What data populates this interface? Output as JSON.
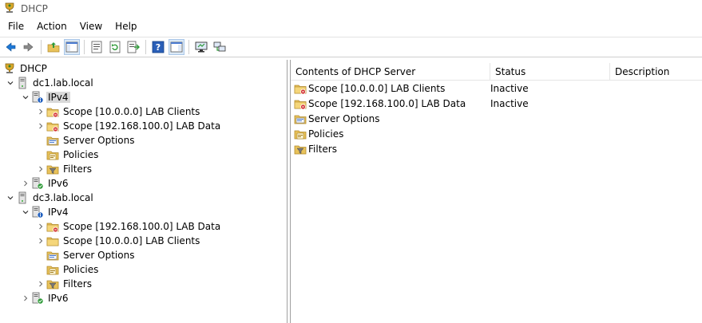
{
  "window": {
    "title": "DHCP"
  },
  "menu": {
    "items": [
      "File",
      "Action",
      "View",
      "Help"
    ]
  },
  "toolbar": {
    "buttons": [
      "back-arrow-icon",
      "forward-arrow-icon",
      "up-folder-icon",
      "show-hide-tree-icon",
      "properties-icon",
      "refresh-icon",
      "export-list-icon",
      "help-icon",
      "action-pane-icon",
      "monitor-icon",
      "network-icon"
    ]
  },
  "tree": {
    "root": "DHCP",
    "servers": [
      {
        "name": "dc1.lab.local",
        "ipv4": "IPv4",
        "children": [
          "Scope [10.0.0.0] LAB Clients",
          "Scope [192.168.100.0] LAB Data",
          "Server Options",
          "Policies",
          "Filters"
        ],
        "ipv6": "IPv6"
      },
      {
        "name": "dc3.lab.local",
        "ipv4": "IPv4",
        "children": [
          "Scope [192.168.100.0] LAB Data",
          "Scope [10.0.0.0] LAB Clients",
          "Server Options",
          "Policies",
          "Filters"
        ],
        "ipv6": "IPv6"
      }
    ]
  },
  "list": {
    "columns": [
      "Contents of DHCP Server",
      "Status",
      "Description"
    ],
    "rows": [
      {
        "name": "Scope [10.0.0.0] LAB Clients",
        "status": "Inactive",
        "description": ""
      },
      {
        "name": "Scope [192.168.100.0] LAB Data",
        "status": "Inactive",
        "description": ""
      },
      {
        "name": "Server Options",
        "status": "",
        "description": ""
      },
      {
        "name": "Policies",
        "status": "",
        "description": ""
      },
      {
        "name": "Filters",
        "status": "",
        "description": ""
      }
    ]
  },
  "colors": {
    "selection": "#d9d9d9",
    "accent": "#0063b1",
    "folder": "#e8c25a"
  }
}
